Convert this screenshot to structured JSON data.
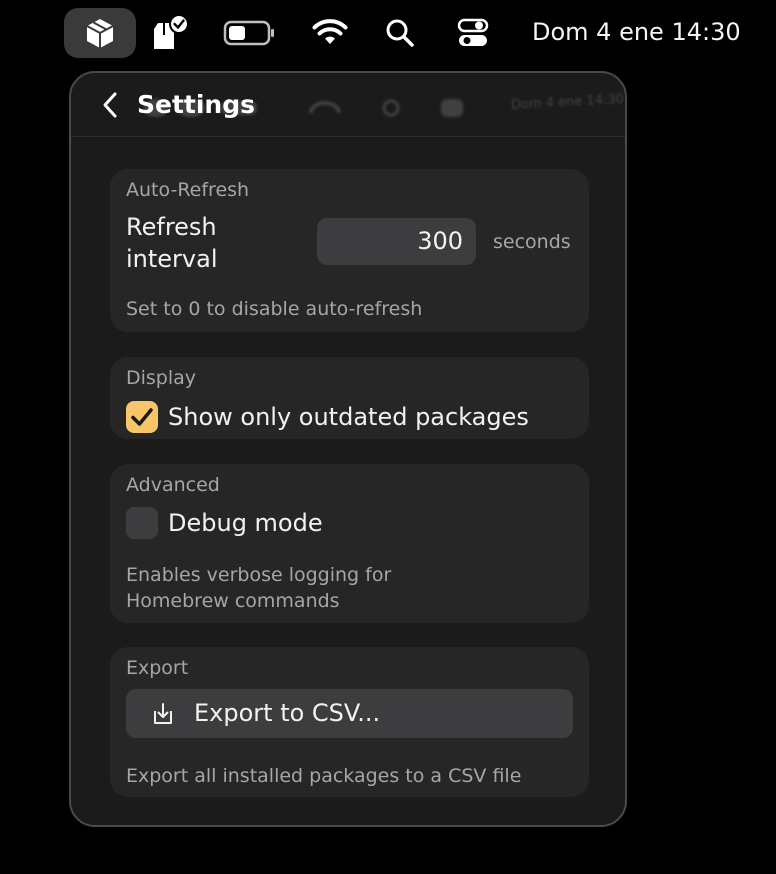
{
  "menubar": {
    "app_icon": "package-box-icon",
    "icons": [
      "package-check-icon",
      "battery-icon",
      "wifi-icon",
      "search-icon",
      "control-center-icon"
    ],
    "clock": "Dom 4 ene 14:30"
  },
  "panel": {
    "title": "Settings",
    "back_icon": "chevron-left-icon"
  },
  "auto_refresh": {
    "title": "Auto-Refresh",
    "label_line1": "Refresh",
    "label_line2": "interval",
    "value": "300",
    "unit": "seconds",
    "note": "Set to 0 to disable auto-refresh"
  },
  "display": {
    "title": "Display",
    "checkbox_label": "Show only outdated packages",
    "checked": true
  },
  "advanced": {
    "title": "Advanced",
    "checkbox_label": "Debug mode",
    "checked": false,
    "note_line1": "Enables verbose logging for",
    "note_line2": "Homebrew commands"
  },
  "export": {
    "title": "Export",
    "button_label": "Export to CSV...",
    "button_icon": "download-icon",
    "note": "Export all installed packages to a CSV file"
  },
  "colors": {
    "accent_checkbox": "#f7c56a",
    "panel_bg": "#1b1b1b",
    "section_bg": "#262626"
  }
}
